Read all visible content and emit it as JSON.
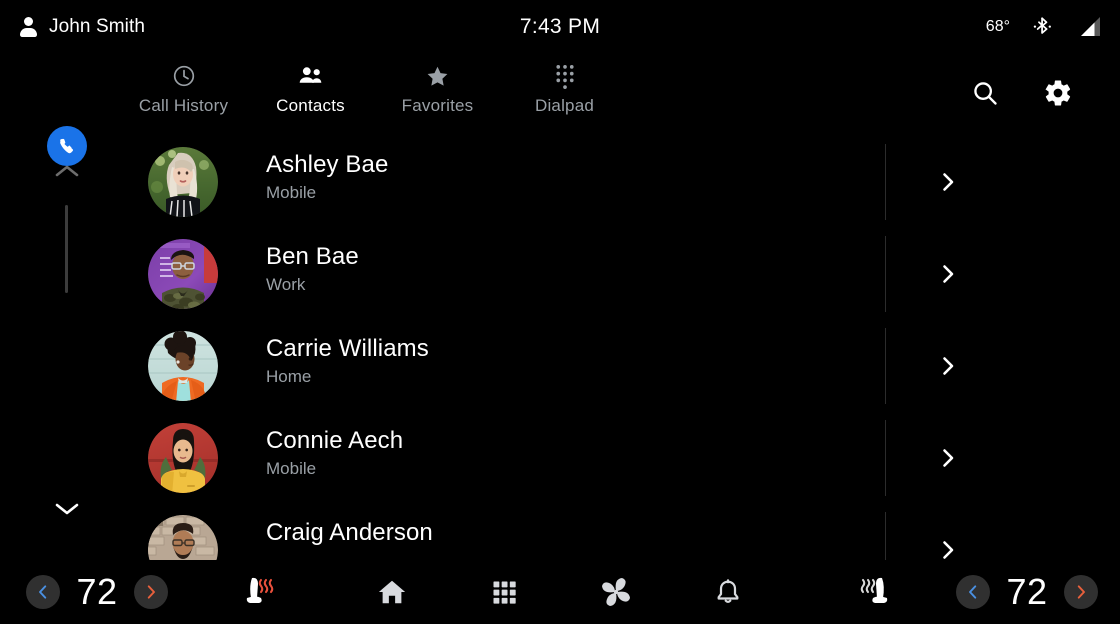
{
  "status_bar": {
    "user_name": "John Smith",
    "time": "7:43 PM",
    "outside_temp": "68°",
    "person_icon": "person-icon",
    "bluetooth_icon": "bluetooth-icon",
    "signal_icon": "signal-strength-icon"
  },
  "app": {
    "name": "Phone",
    "app_badge_icon": "phone-handset-icon"
  },
  "tabs": [
    {
      "label": "Call History",
      "icon": "clock-icon",
      "active": false
    },
    {
      "label": "Contacts",
      "icon": "people-icon",
      "active": true
    },
    {
      "label": "Favorites",
      "icon": "star-icon",
      "active": false
    },
    {
      "label": "Dialpad",
      "icon": "dialpad-icon",
      "active": false
    }
  ],
  "top_actions": [
    {
      "name": "search-button",
      "icon": "search-icon"
    },
    {
      "name": "settings-button",
      "icon": "gear-icon"
    }
  ],
  "scrollbar": {
    "up_icon": "chevron-up-icon",
    "down_icon": "chevron-down-icon"
  },
  "contacts": [
    {
      "name": "Ashley Bae",
      "label": "Mobile",
      "chevron": "chevron-right-icon",
      "avatar": "ashley"
    },
    {
      "name": "Ben Bae",
      "label": "Work",
      "chevron": "chevron-right-icon",
      "avatar": "ben"
    },
    {
      "name": "Carrie Williams",
      "label": "Home",
      "chevron": "chevron-right-icon",
      "avatar": "carrie"
    },
    {
      "name": "Connie Aech",
      "label": "Mobile",
      "chevron": "chevron-right-icon",
      "avatar": "connie"
    },
    {
      "name": "Craig Anderson",
      "label": "",
      "chevron": "chevron-right-icon",
      "avatar": "craig"
    }
  ],
  "bottom_bar": {
    "driver_climate": {
      "decrease_label": "‹",
      "temperature": "72",
      "increase_label": "›",
      "decrease_color": "#4a90e2",
      "increase_color": "#e8603c",
      "seat_heater_icon": "heated-seat-icon",
      "seat_heater_active": true,
      "seat_heat_color": "#e8503c"
    },
    "passenger_climate": {
      "decrease_label": "‹",
      "temperature": "72",
      "increase_label": "›",
      "decrease_color": "#4a90e2",
      "increase_color": "#e8603c",
      "seat_heater_icon": "heated-seat-icon",
      "seat_heater_active": false,
      "seat_heat_color": "#d8d8d8"
    },
    "nav_items": [
      {
        "name": "home-button",
        "icon": "home-icon"
      },
      {
        "name": "apps-button",
        "icon": "grid-apps-icon"
      },
      {
        "name": "climate-button",
        "icon": "fan-icon"
      },
      {
        "name": "notifications-button",
        "icon": "bell-icon"
      }
    ]
  },
  "colors": {
    "background": "#000000",
    "accent_blue": "#1a73e8",
    "text_primary": "#ffffff",
    "text_secondary": "#9aa0a6",
    "divider": "#2c2c2c"
  }
}
